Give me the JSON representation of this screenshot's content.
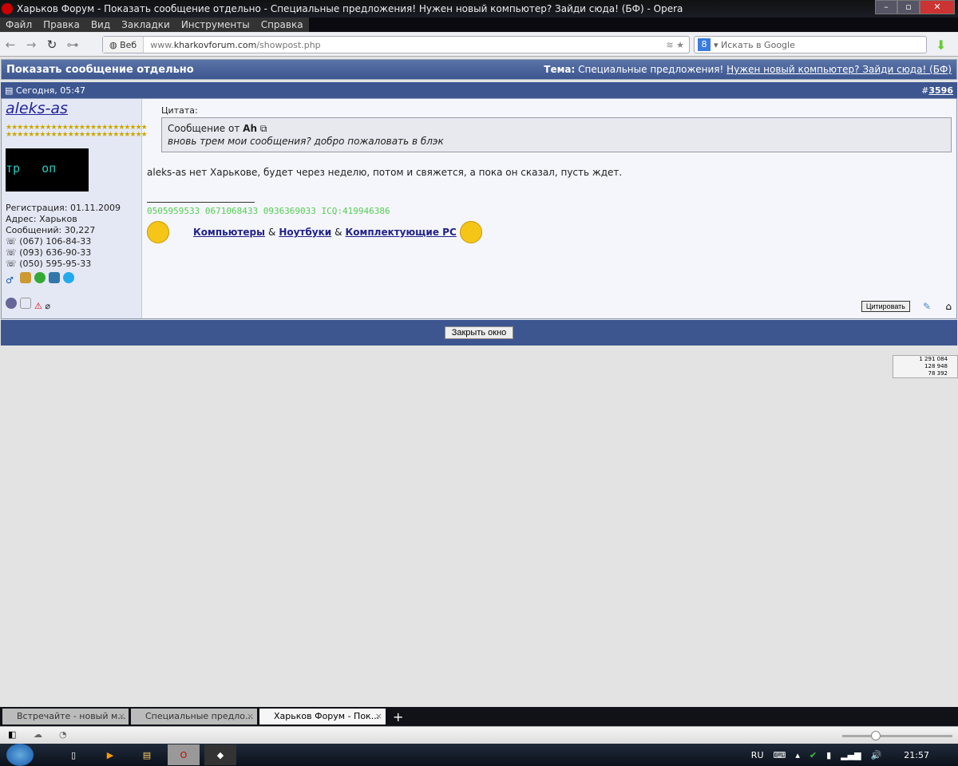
{
  "window": {
    "title": "Харьков Форум - Показать сообщение отдельно - Специальные предложения! Нужен новый компьютер? Зайди сюда! (БФ) - Opera"
  },
  "menu": [
    "Файл",
    "Правка",
    "Вид",
    "Закладки",
    "Инструменты",
    "Справка"
  ],
  "address": {
    "web_label": "Веб",
    "url_prefix": "www.",
    "url_domain": "kharkovforum.com",
    "url_path": "/showpost.php"
  },
  "search": {
    "placeholder": "Искать в Google"
  },
  "header": {
    "title": "Показать сообщение отдельно",
    "topic_label": "Тема:",
    "topic_prefix": "Специальные предложения!",
    "topic_link": "Нужен новый компьютер? Зайди сюда! (БФ)"
  },
  "post": {
    "date": "Сегодня, 05:47",
    "number_prefix": "#",
    "number": "3596",
    "user": {
      "name": "aleks-as",
      "avatar_text": "тр   оп",
      "registration": "Регистрация: 01.11.2009",
      "address": "Адрес: Харьков",
      "posts": "Сообщений: 30,227",
      "phones": [
        "(067) 106-84-33",
        "(093) 636-90-33",
        "(050) 595-95-33"
      ]
    },
    "quote_label": "Цитата:",
    "quote_from": "Сообщение от",
    "quote_author": "Ah",
    "quote_text": "вновь трем мои сообщения? добро пожаловать в блэк",
    "message": "aleks-as нет Харькове, будет через неделю, потом и свяжется, а пока он сказал, пусть ждет.",
    "signature_phones": "0505959533 0671068433 0936369033 ICQ:419946386",
    "links": [
      "Компьютеры",
      "Ноутбуки",
      "Комплектующие PC"
    ],
    "amp": "&",
    "quote_button": "Цитировать"
  },
  "close_button": "Закрыть окно",
  "counter": [
    "1 291 084",
    "128 948",
    "78 392"
  ],
  "tabs": [
    "Встречайте - новый м...",
    "Специальные предло...",
    "Харьков Форум - Пок..."
  ],
  "tray": {
    "lang": "RU",
    "time": "21:57"
  }
}
